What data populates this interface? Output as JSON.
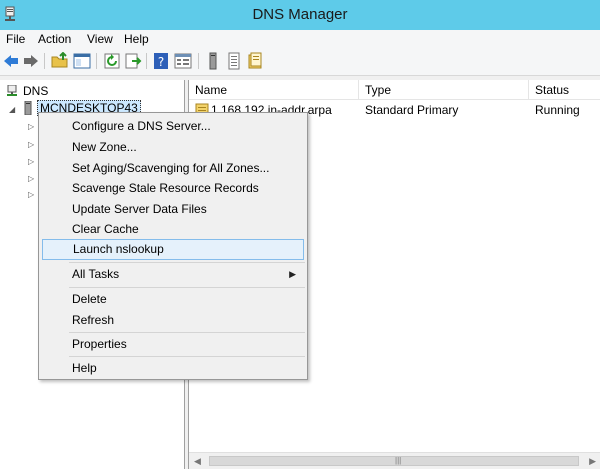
{
  "window": {
    "title": "DNS Manager",
    "accent": "#5ecbe9"
  },
  "menubar": {
    "items": [
      "File",
      "Action",
      "View",
      "Help"
    ]
  },
  "toolbar": {
    "buttons": [
      "back-arrow-icon",
      "forward-arrow-icon",
      "folder-up-icon",
      "show-hide-tree-icon",
      "refresh-icon",
      "export-list-icon",
      "help-icon",
      "properties-icon",
      "server-icon",
      "records-list-icon",
      "zone-icon"
    ]
  },
  "tree": {
    "root": "DNS",
    "server": "MCNDESKTOP43"
  },
  "list": {
    "columns": [
      "Name",
      "Type",
      "Status"
    ],
    "rows": [
      {
        "name": "1.168.192.in-addr.arpa",
        "type": "Standard Primary",
        "status": "Running"
      }
    ]
  },
  "context_menu": {
    "items": [
      "Configure a DNS Server...",
      "New Zone...",
      "Set Aging/Scavenging for All Zones...",
      "Scavenge Stale Resource Records",
      "Update Server Data Files",
      "Clear Cache",
      "Launch nslookup",
      "All Tasks",
      "Delete",
      "Refresh",
      "Properties",
      "Help"
    ],
    "highlighted": "Launch nslookup"
  }
}
